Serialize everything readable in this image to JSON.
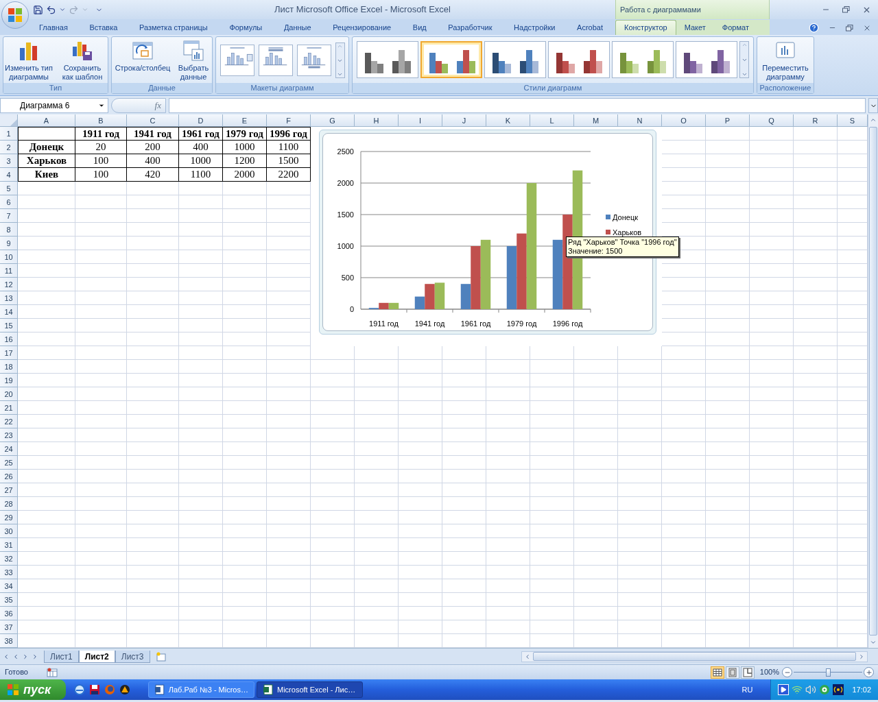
{
  "window": {
    "title": "Лист Microsoft Office Excel - Microsoft Excel",
    "context_title": "Работа с диаграммами"
  },
  "tabs": [
    {
      "label": "Главная",
      "selected": false,
      "contextual": false
    },
    {
      "label": "Вставка",
      "selected": false,
      "contextual": false
    },
    {
      "label": "Разметка страницы",
      "selected": false,
      "contextual": false
    },
    {
      "label": "Формулы",
      "selected": false,
      "contextual": false
    },
    {
      "label": "Данные",
      "selected": false,
      "contextual": false
    },
    {
      "label": "Рецензирование",
      "selected": false,
      "contextual": false
    },
    {
      "label": "Вид",
      "selected": false,
      "contextual": false
    },
    {
      "label": "Разработчик",
      "selected": false,
      "contextual": false
    },
    {
      "label": "Надстройки",
      "selected": false,
      "contextual": false
    },
    {
      "label": "Acrobat",
      "selected": false,
      "contextual": false
    },
    {
      "label": "Конструктор",
      "selected": true,
      "contextual": true
    },
    {
      "label": "Макет",
      "selected": false,
      "contextual": true
    },
    {
      "label": "Формат",
      "selected": false,
      "contextual": true
    }
  ],
  "ribbon": {
    "type_group": {
      "label": "Тип",
      "buttons": [
        {
          "kind": "change",
          "lines": [
            "Изменить тип",
            "диаграммы"
          ]
        },
        {
          "kind": "template",
          "lines": [
            "Сохранить",
            "как шаблон"
          ]
        }
      ]
    },
    "data_group": {
      "label": "Данные",
      "buttons": [
        {
          "kind": "switch",
          "lines": [
            "Строка/столбец"
          ]
        },
        {
          "kind": "select",
          "lines": [
            "Выбрать",
            "данные"
          ]
        }
      ]
    },
    "layouts_group": {
      "label": "Макеты диаграмм",
      "layouts": [
        {
          "kind": "legend"
        },
        {
          "kind": "title"
        },
        {
          "kind": "bottom"
        }
      ]
    },
    "styles_group": {
      "label": "Стили диаграмм",
      "styles": [
        {
          "kind": "gray",
          "selected": false
        },
        {
          "kind": "multi",
          "selected": true
        },
        {
          "kind": "blue",
          "selected": false
        },
        {
          "kind": "red",
          "selected": false
        },
        {
          "kind": "green",
          "selected": false
        },
        {
          "kind": "purple",
          "selected": false
        }
      ]
    },
    "location_group": {
      "label": "Расположение",
      "buttons": [
        {
          "kind": "move",
          "lines": [
            "Переместить",
            "диаграмму"
          ]
        }
      ]
    }
  },
  "formula_bar": {
    "name_box": "Диаграмма 6",
    "function_label": "fx"
  },
  "sheet": {
    "column_headers": [
      "A",
      "B",
      "C",
      "D",
      "E",
      "F",
      "G",
      "H",
      "I",
      "J",
      "K",
      "L",
      "M",
      "N",
      "O",
      "P",
      "Q",
      "R",
      "S"
    ],
    "row_headers": [
      "1",
      "2",
      "3",
      "4",
      "5",
      "6",
      "7",
      "8",
      "9",
      "10",
      "11",
      "12",
      "13",
      "14",
      "15",
      "16",
      "17",
      "18",
      "19",
      "20",
      "21",
      "22",
      "23",
      "24",
      "25",
      "26",
      "27",
      "28",
      "29",
      "30",
      "31",
      "32",
      "33",
      "34",
      "35",
      "36",
      "37",
      "38"
    ],
    "rows": [
      [
        "",
        "1911 год",
        "1941 год",
        "1961 год",
        "1979 год",
        "1996 год"
      ],
      [
        "Донецк",
        "20",
        "200",
        "400",
        "1000",
        "1100"
      ],
      [
        "Харьков",
        "100",
        "400",
        "1000",
        "1200",
        "1500"
      ],
      [
        "Киев",
        "100",
        "420",
        "1100",
        "2000",
        "2200"
      ]
    ]
  },
  "chart": {
    "tooltip": [
      "Ряд \"Харьков\" Точка \"1996 год\"",
      "Значение: 1500"
    ],
    "chart_data": {
      "type": "bar",
      "categories": [
        "1911 год",
        "1941 год",
        "1961 год",
        "1979 год",
        "1996 год"
      ],
      "series": [
        {
          "name": "Донецк",
          "color": "#4f81bd",
          "values": [
            20,
            200,
            400,
            1000,
            1100
          ]
        },
        {
          "name": "Харьков",
          "color": "#c0504d",
          "values": [
            100,
            400,
            1000,
            1200,
            1500
          ]
        },
        {
          "color": "#9bbb59",
          "values": [
            100,
            420,
            1100,
            2000,
            2200
          ]
        }
      ],
      "ylim": [
        0,
        2500
      ],
      "yticks": [
        0,
        500,
        1000,
        1500,
        2000,
        2500
      ],
      "grid": true,
      "legend": true
    }
  },
  "sheet_tabs": [
    {
      "label": "Лист1",
      "selected": false
    },
    {
      "label": "Лист2",
      "selected": true
    },
    {
      "label": "Лист3",
      "selected": false
    }
  ],
  "status_bar": {
    "status": "Готово",
    "views": [
      {
        "kind": "normal",
        "selected": true
      },
      {
        "kind": "layout",
        "selected": false
      },
      {
        "kind": "pagebreak",
        "selected": false
      }
    ],
    "zoom": "100%",
    "zoom_level": {
      "level": 0.5
    }
  },
  "taskbar": {
    "start": "пуск",
    "quick_launch": [
      {
        "kind": "ie"
      },
      {
        "kind": "save"
      },
      {
        "kind": "firefox"
      },
      {
        "kind": "aimp"
      }
    ],
    "tasks": [
      {
        "kind": "word",
        "label": "Лаб.Раб №3 - Micros…",
        "selected": false
      },
      {
        "kind": "excel",
        "label": "Microsoft Excel - Лис…",
        "selected": true
      }
    ],
    "language": "RU",
    "tray": [
      {
        "kind": "play"
      },
      {
        "kind": "network"
      },
      {
        "kind": "speaker"
      },
      {
        "kind": "ring"
      },
      {
        "kind": "radio"
      }
    ],
    "clock": "17:02"
  }
}
